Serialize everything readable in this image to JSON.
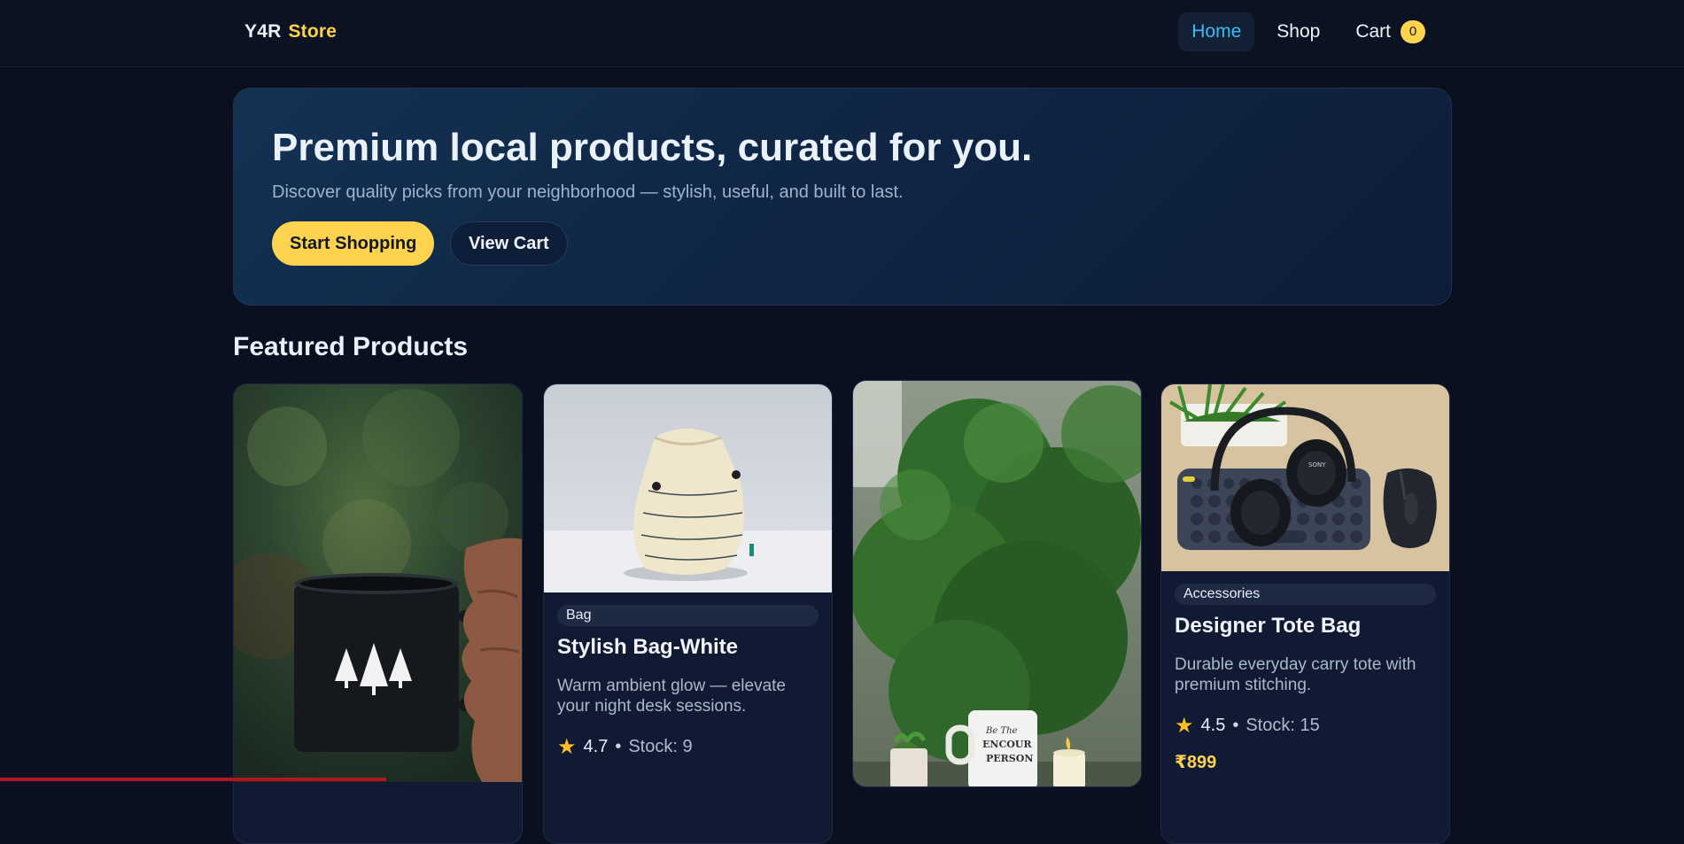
{
  "brand": {
    "part1": "Y4R",
    "part2": "Store"
  },
  "nav": {
    "home": "Home",
    "shop": "Shop",
    "cart": "Cart",
    "cart_count": "0"
  },
  "hero": {
    "title": "Premium local products, curated for you.",
    "subtitle": "Discover quality picks from your neighborhood — stylish, useful, and built to last.",
    "primary_button": "Start Shopping",
    "secondary_button": "View Cart"
  },
  "featured": {
    "title": "Featured Products",
    "products": [
      {
        "image": "black enamel mug with tree print held in hand"
      },
      {
        "image": "cream drawstring bag",
        "category": "Bag",
        "name": "Stylish Bag-White",
        "description": "Warm ambient glow — elevate your night desk sessions.",
        "rating": "4.7",
        "stock": "Stock: 9"
      },
      {
        "image": "green tree foliage with mug and candle on table"
      },
      {
        "image": "headphones, keyboard and mouse on desk",
        "category": "Accessories",
        "name": "Designer Tote Bag",
        "description": "Durable everyday carry tote with premium stitching.",
        "rating": "4.5",
        "stock": "Stock: 15",
        "price": "₹899"
      }
    ]
  },
  "icons": {
    "rating": "star-icon"
  },
  "colors": {
    "background": "#0a1020",
    "accent": "#ffd34d",
    "link_active": "#38bdf8"
  }
}
